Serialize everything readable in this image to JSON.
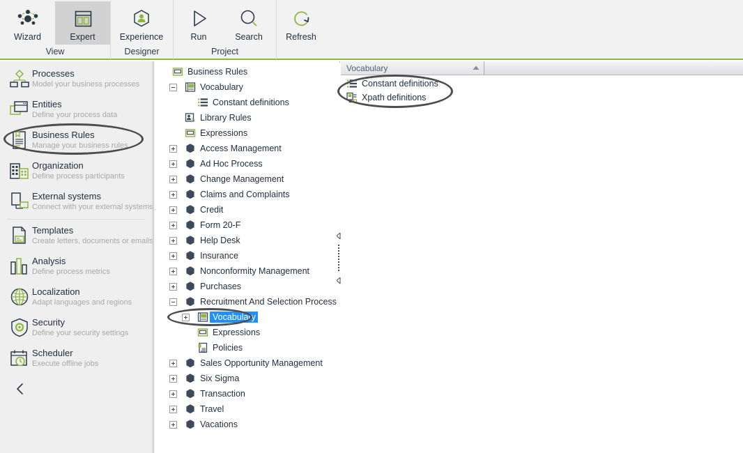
{
  "ribbon": {
    "groups": [
      {
        "label": "View",
        "buttons": [
          {
            "label": "Wizard",
            "icon": "wizard-icon",
            "selected": false
          },
          {
            "label": "Expert",
            "icon": "expert-layout-icon",
            "selected": true
          }
        ]
      },
      {
        "label": "Designer",
        "buttons": [
          {
            "label": "Experience",
            "icon": "experience-person-icon",
            "selected": false
          }
        ]
      },
      {
        "label": "Project",
        "buttons": [
          {
            "label": "Run",
            "icon": "play-icon",
            "selected": false
          },
          {
            "label": "Search",
            "icon": "search-icon",
            "selected": false
          }
        ]
      },
      {
        "label": "",
        "buttons": [
          {
            "label": "Refresh",
            "icon": "refresh-icon",
            "selected": false
          }
        ]
      }
    ]
  },
  "sidebar": {
    "items": [
      {
        "title": "Processes",
        "subtitle": "Model your business processes",
        "icon": "processes-icon"
      },
      {
        "title": "Entities",
        "subtitle": "Define your process data",
        "icon": "entities-icon"
      },
      {
        "title": "Business  Rules",
        "subtitle": "Manage your business rules",
        "icon": "business-rules-icon",
        "highlighted": true
      },
      {
        "title": "Organization",
        "subtitle": "Define process participants",
        "icon": "organization-icon"
      },
      {
        "title": "External systems",
        "subtitle": "Connect with your external systems",
        "icon": "external-systems-icon"
      },
      {
        "title": "Templates",
        "subtitle": "Create letters, documents  or emails",
        "icon": "templates-icon"
      },
      {
        "title": "Analysis",
        "subtitle": "Define  process  metrics",
        "icon": "analysis-icon"
      },
      {
        "title": "Localization",
        "subtitle": "Adapt  languages  and regions",
        "icon": "localization-icon"
      },
      {
        "title": "Security",
        "subtitle": "Define  your  security  settings",
        "icon": "security-icon"
      },
      {
        "title": "Scheduler",
        "subtitle": "Execute offline  jobs",
        "icon": "scheduler-icon"
      }
    ],
    "collapse_icon": "chevron-left-icon"
  },
  "tree": {
    "nodes": [
      {
        "label": "Business Rules",
        "indent": 0,
        "expander": "none",
        "icon": "window-green-icon"
      },
      {
        "label": "Vocabulary",
        "indent": 1,
        "expander": "minus",
        "icon": "vocabulary-ab-icon"
      },
      {
        "label": "Constant definitions",
        "indent": 2,
        "expander": "none",
        "icon": "constant-definitions-icon"
      },
      {
        "label": "Library Rules",
        "indent": 1,
        "expander": "none",
        "icon": "library-rules-icon"
      },
      {
        "label": "Expressions",
        "indent": 1,
        "expander": "none",
        "icon": "window-green-icon"
      },
      {
        "label": "Access Management",
        "indent": 1,
        "expander": "plus",
        "icon": "module-hex-icon"
      },
      {
        "label": "Ad Hoc Process",
        "indent": 1,
        "expander": "plus",
        "icon": "module-hex-icon"
      },
      {
        "label": "Change Management",
        "indent": 1,
        "expander": "plus",
        "icon": "module-hex-icon"
      },
      {
        "label": "Claims and Complaints",
        "indent": 1,
        "expander": "plus",
        "icon": "module-hex-icon"
      },
      {
        "label": "Credit",
        "indent": 1,
        "expander": "plus",
        "icon": "module-hex-icon"
      },
      {
        "label": "Form 20-F",
        "indent": 1,
        "expander": "plus",
        "icon": "module-hex-icon"
      },
      {
        "label": "Help Desk",
        "indent": 1,
        "expander": "plus",
        "icon": "module-hex-icon"
      },
      {
        "label": "Insurance",
        "indent": 1,
        "expander": "plus",
        "icon": "module-hex-icon"
      },
      {
        "label": "Nonconformity Management",
        "indent": 1,
        "expander": "plus",
        "icon": "module-hex-icon"
      },
      {
        "label": "Purchases",
        "indent": 1,
        "expander": "plus",
        "icon": "module-hex-icon"
      },
      {
        "label": "Recruitment And Selection Process",
        "indent": 1,
        "expander": "minus",
        "icon": "module-hex-icon"
      },
      {
        "label": "Vocabulary",
        "indent": 2,
        "expander": "plus",
        "icon": "vocabulary-ab-icon",
        "selected": true
      },
      {
        "label": "Expressions",
        "indent": 2,
        "expander": "none",
        "icon": "window-green-icon"
      },
      {
        "label": "Policies",
        "indent": 2,
        "expander": "none",
        "icon": "policies-icon"
      },
      {
        "label": "Sales Opportunity Management",
        "indent": 1,
        "expander": "plus",
        "icon": "module-hex-icon"
      },
      {
        "label": "Six Sigma",
        "indent": 1,
        "expander": "plus",
        "icon": "module-hex-icon"
      },
      {
        "label": "Transaction",
        "indent": 1,
        "expander": "plus",
        "icon": "module-hex-icon"
      },
      {
        "label": "Travel",
        "indent": 1,
        "expander": "plus",
        "icon": "module-hex-icon"
      },
      {
        "label": "Vacations",
        "indent": 1,
        "expander": "plus",
        "icon": "module-hex-icon"
      }
    ]
  },
  "right_panel": {
    "tab": {
      "label": "Vocabulary",
      "arrow_icon": "triangle-up-icon"
    },
    "items": [
      {
        "label": "Constant definitions",
        "icon": "constant-definitions-icon"
      },
      {
        "label": "Xpath definitions",
        "icon": "xpath-definitions-icon"
      }
    ]
  },
  "splitter": {
    "top_arrow_icon": "triangle-left-icon",
    "bottom_arrow_icon": "triangle-left-icon",
    "grip_icon": "grip-dots-icon"
  },
  "colors": {
    "accent_green": "#8cb63c",
    "selection_blue": "#1e90ff",
    "annotation_gray": "#4d4d4d",
    "ribbon_bg": "#f2f2f2",
    "sidebar_bg": "#efefef",
    "text_dark": "#1f2d3d",
    "text_muted": "#a8a8a8"
  }
}
